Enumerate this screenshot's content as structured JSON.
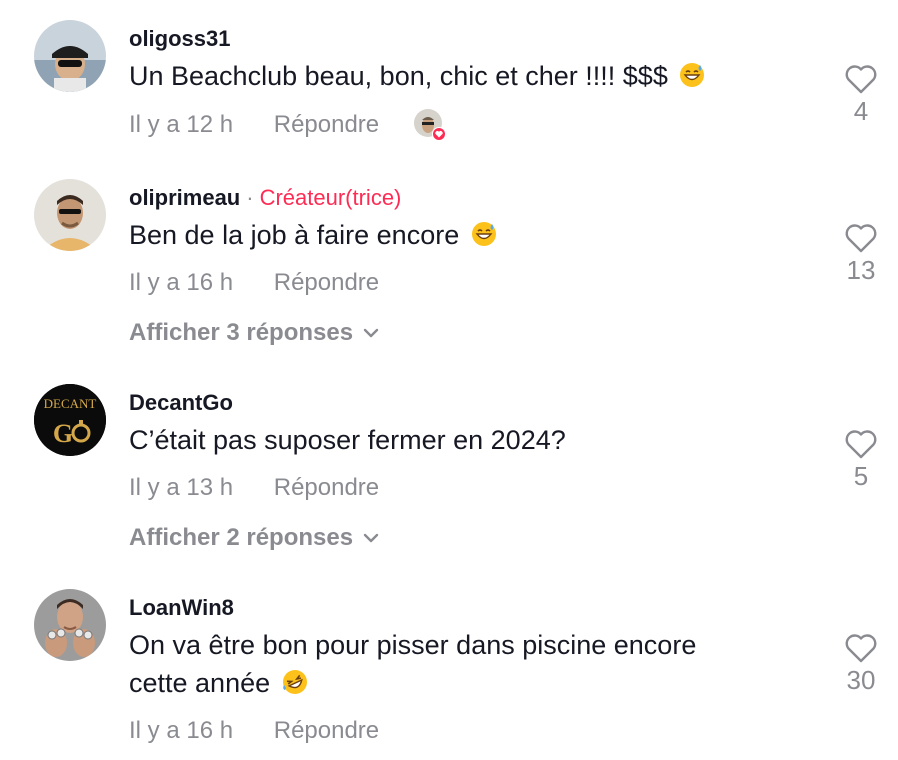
{
  "comments": [
    {
      "username": "oligoss31",
      "text": "Un Beachclub beau, bon, chic et cher !!!! $$$",
      "emoji": "sweat-smile",
      "time": "Il y a 12 h",
      "reply_label": "Répondre",
      "likes": "4",
      "liked_by_creator": true
    },
    {
      "username": "oliprimeau",
      "separator": "·",
      "badge": "Créateur(trice)",
      "text": "Ben de la job à faire encore",
      "emoji": "sweat-smile",
      "time": "Il y a 16 h",
      "reply_label": "Répondre",
      "likes": "13",
      "view_replies": "Afficher 3 réponses"
    },
    {
      "username": "DecantGo",
      "avatar_text_top": "DECANT",
      "avatar_text_bottom": "G",
      "text": "C’était pas suposer fermer en 2024?",
      "time": "Il y a 13 h",
      "reply_label": "Répondre",
      "likes": "5",
      "view_replies": "Afficher 2 réponses"
    },
    {
      "username": "LoanWin8",
      "text_line1": "On va être bon pour pisser dans piscine encore",
      "text_line2": "cette année",
      "emoji": "rofl",
      "time": "Il y a 16 h",
      "reply_label": "Répondre",
      "likes": "30"
    }
  ],
  "colors": {
    "primary_text": "#161823",
    "secondary_text": "#8a8b91",
    "creator_badge": "#fe2c55",
    "like_outline": "#8a8b91"
  }
}
